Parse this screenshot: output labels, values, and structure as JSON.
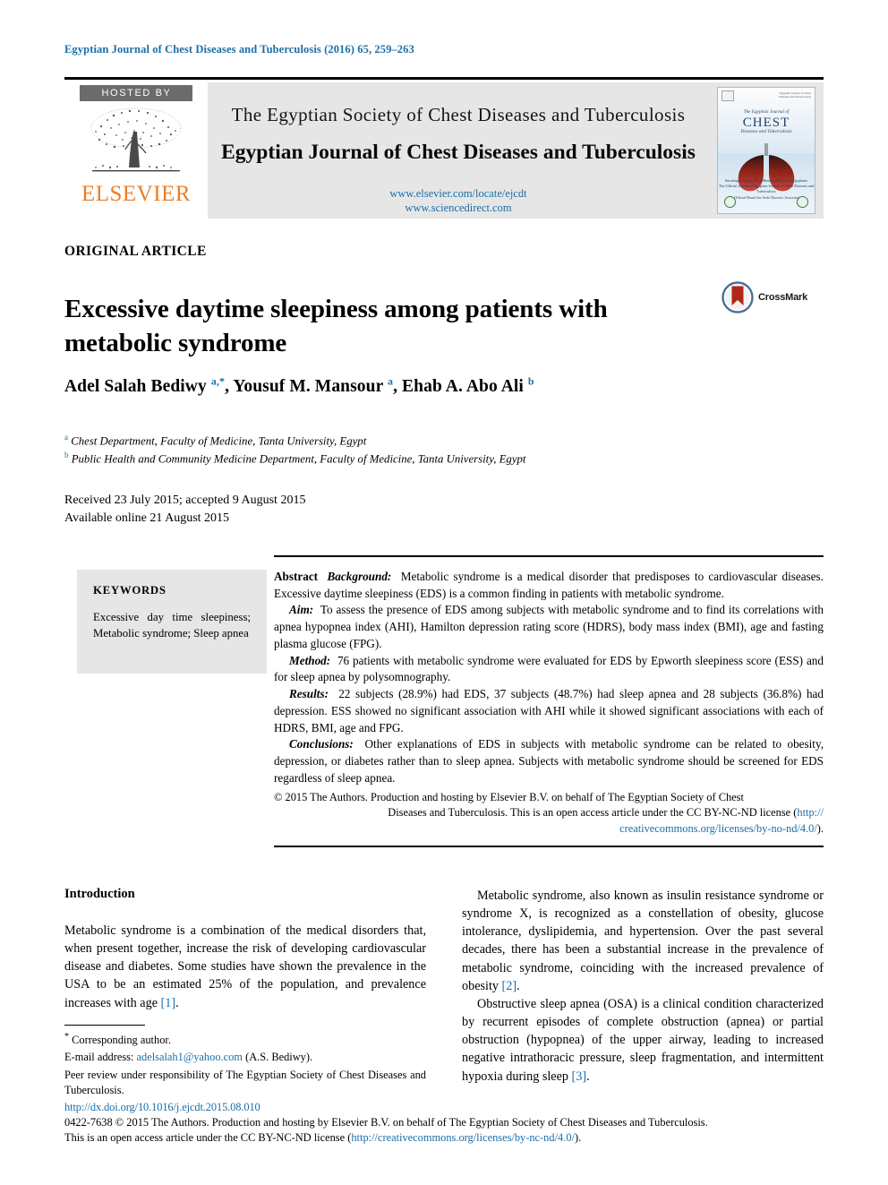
{
  "running_head": "Egyptian Journal of Chest Diseases and Tuberculosis (2016) 65, 259–263",
  "masthead": {
    "hosted_by": "HOSTED BY",
    "publisher": "ELSEVIER",
    "society_line": "The Egyptian Society of Chest Diseases and Tuberculosis",
    "journal_line": "Egyptian Journal of Chest Diseases and Tuberculosis",
    "url_locate": "www.elsevier.com/locate/ejcdt",
    "url_sciencedirect": "www.sciencedirect.com",
    "cover": {
      "line_top": "The Egyptian Journal of",
      "title": "CHEST",
      "subtitle": "Diseases and Tuberculosis",
      "footer_line1": "Smoking in Egypt: Why Mentioned Cited in Egyptians",
      "footer_line2": "The Official Journal of Egyptian Society of Chest Diseases and Tuberculosis",
      "footer_line3": "& Official Board for Arab Thoracic Association",
      "topright": "Egyptian Journal of Chest Diseases and Tuberculosis"
    }
  },
  "article": {
    "type": "ORIGINAL ARTICLE",
    "title": "Excessive daytime sleepiness among patients with metabolic syndrome",
    "crossmark_label": "CrossMark",
    "authors_html": "Adel Salah Bediwy <sup>a,*</sup>, Yousuf M. Mansour <sup>a</sup>, Ehab A. Abo Ali <sup>b</sup>",
    "affiliation_a": "Chest Department, Faculty of Medicine, Tanta University, Egypt",
    "affiliation_b": "Public Health and Community Medicine Department, Faculty of Medicine, Tanta University, Egypt",
    "received_line": "Received 23 July 2015; accepted 9 August 2015",
    "available_line": "Available online 21 August 2015"
  },
  "keywords": {
    "heading": "KEYWORDS",
    "items": "Excessive day time sleepiness; Metabolic syndrome; Sleep apnea"
  },
  "abstract": {
    "label": "Abstract",
    "background_label": "Background:",
    "background_text": "Metabolic syndrome is a medical disorder that predisposes to cardiovascular diseases. Excessive daytime sleepiness (EDS) is a common finding in patients with metabolic syndrome.",
    "aim_label": "Aim:",
    "aim_text": "To assess the presence of EDS among subjects with metabolic syndrome and to find its correlations with apnea hypopnea index (AHI), Hamilton depression rating score (HDRS), body mass index (BMI), age and fasting plasma glucose (FPG).",
    "method_label": "Method:",
    "method_text": "76 patients with metabolic syndrome were evaluated for EDS by Epworth sleepiness score (ESS) and for sleep apnea by polysomnography.",
    "results_label": "Results:",
    "results_text": "22 subjects (28.9%) had EDS, 37 subjects (48.7%) had sleep apnea and 28 subjects (36.8%) had depression. ESS showed no significant association with AHI while it showed significant associations with each of HDRS, BMI, age and FPG.",
    "conclusions_label": "Conclusions:",
    "conclusions_text": "Other explanations of EDS in subjects with metabolic syndrome can be related to obesity, depression, or diabetes rather than to sleep apnea. Subjects with metabolic syndrome should be screened for EDS regardless of sleep apnea.",
    "copyright_1": "© 2015 The Authors. Production and hosting by Elsevier B.V. on behalf of The Egyptian Society of Chest",
    "copyright_2": "Diseases and Tuberculosis. This is an open access article under the CC BY-NC-ND license (",
    "copyright_link_1": "http://",
    "copyright_link_2": "creativecommons.org/licenses/by-no-nd/4.0/",
    "copyright_3": ")."
  },
  "introduction": {
    "heading": "Introduction",
    "left_para_1": "Metabolic syndrome is a combination of the medical disorders that, when present together, increase the risk of developing cardiovascular disease and diabetes. Some studies have shown the prevalence in the USA to be an estimated 25% of the population, and prevalence increases with age ",
    "left_ref_1": "[1]",
    "right_para_1": "Metabolic syndrome, also known as insulin resistance syndrome or syndrome X, is recognized as a constellation of obesity, glucose intolerance, dyslipidemia, and hypertension. Over the past several decades, there has been a substantial increase in the prevalence of metabolic syndrome, coinciding with the increased prevalence of obesity ",
    "right_ref_1": "[2]",
    "right_para_2": "Obstructive sleep apnea (OSA) is a clinical condition characterized by recurrent episodes of complete obstruction (apnea) or partial obstruction (hypopnea) of the upper airway, leading to increased negative intrathoracic pressure, sleep fragmentation, and intermittent hypoxia during sleep ",
    "right_ref_2": "[3]"
  },
  "footnote": {
    "corresponding": "Corresponding author.",
    "email_label": "E-mail address:",
    "email": "adelsalah1@yahoo.com",
    "email_suffix": "(A.S. Bediwy).",
    "peer_review": "Peer review under responsibility of The Egyptian Society of Chest Diseases and Tuberculosis."
  },
  "page_footer": {
    "doi": "http://dx.doi.org/10.1016/j.ejcdt.2015.08.010",
    "line_1": "0422-7638 © 2015 The Authors. Production and hosting by Elsevier B.V. on behalf of The Egyptian Society of Chest Diseases and Tuberculosis.",
    "line_2_pre": "This is an open access article under the CC BY-NC-ND license (",
    "line_2_link": "http://creativecommons.org/licenses/by-nc-nd/4.0/",
    "line_2_post": ")."
  },
  "colors": {
    "link_blue": "#1a6ea8",
    "elsevier_orange": "#ef7c22",
    "panel_gray": "#e6e6e6",
    "hosted_gray": "#6b6b6b",
    "crossmark_red": "#b0281a"
  }
}
